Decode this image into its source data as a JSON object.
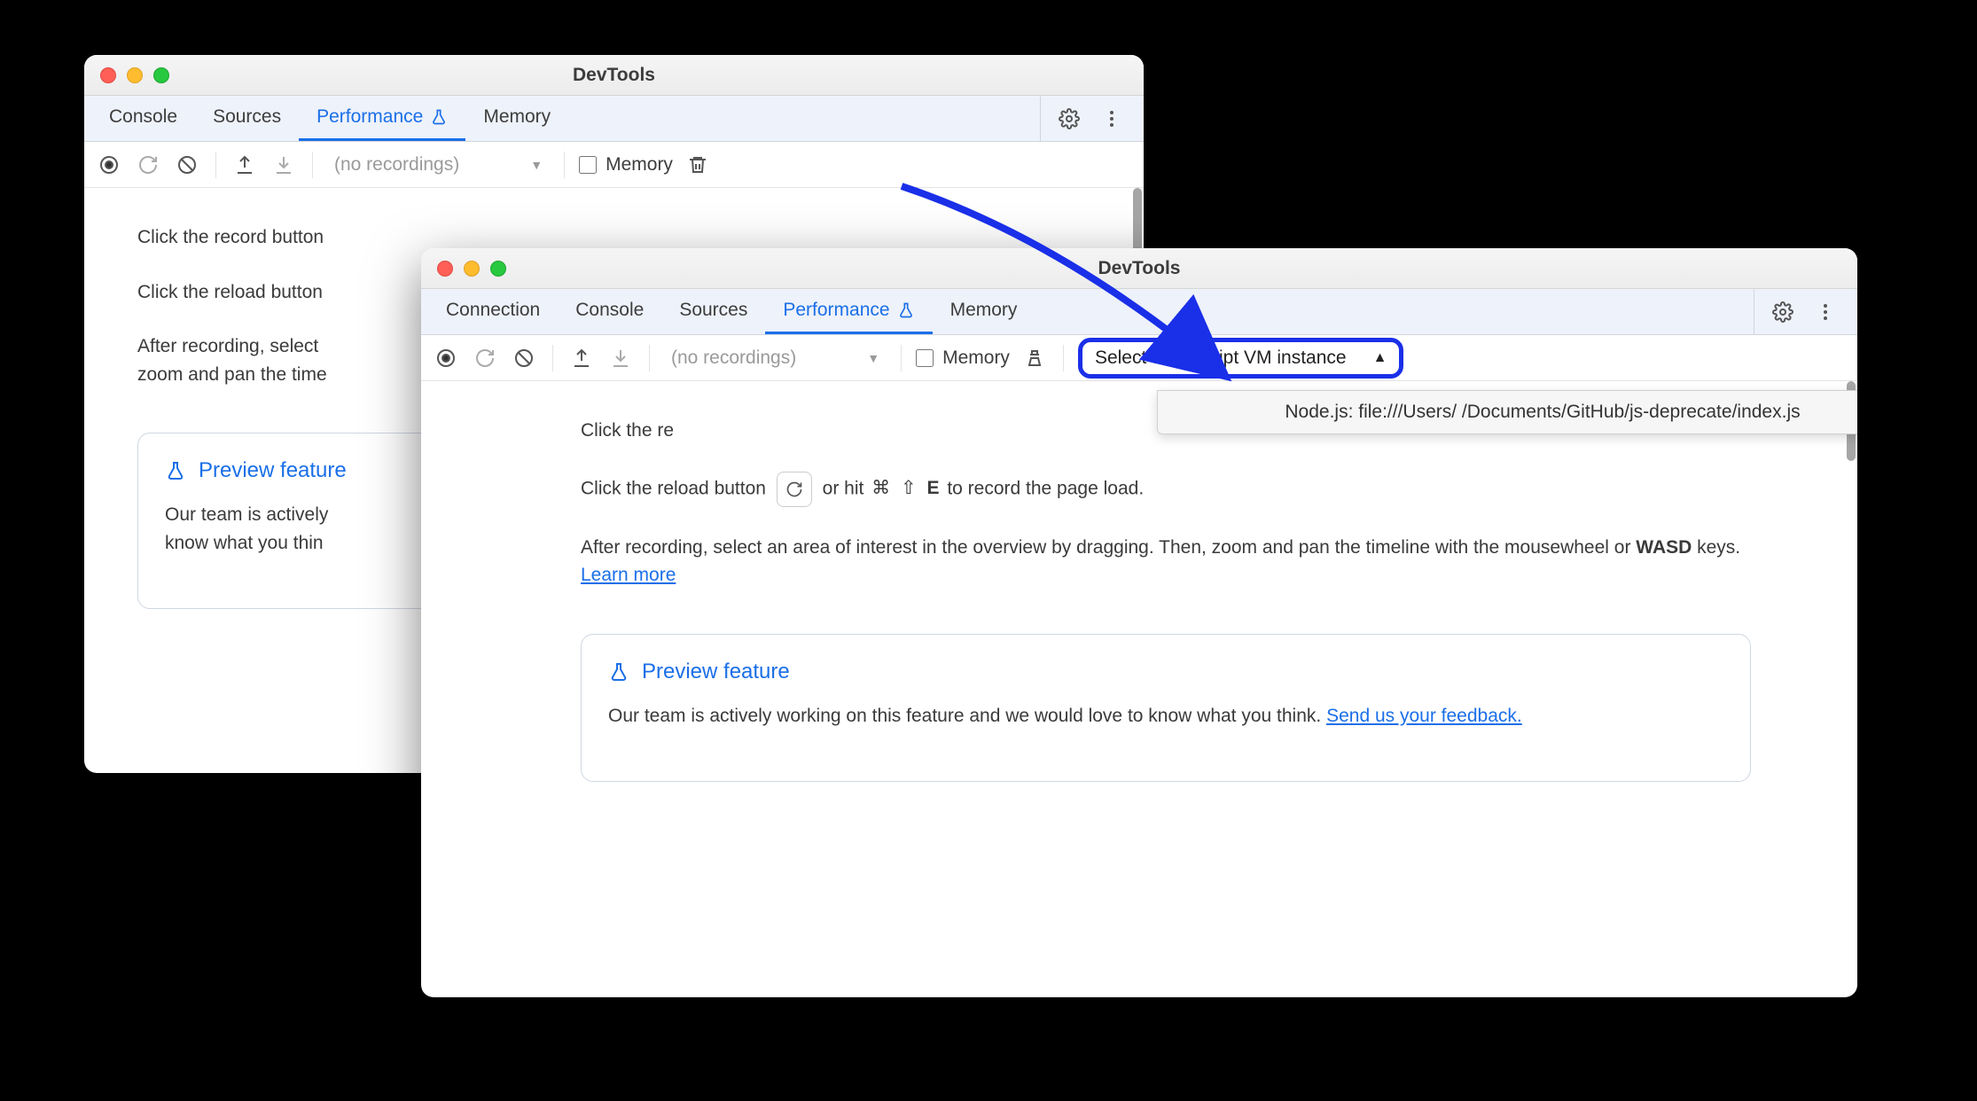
{
  "windowBack": {
    "title": "DevTools",
    "tabs": [
      "Console",
      "Sources",
      "Performance",
      "Memory"
    ],
    "activeTab": "Performance",
    "toolbar": {
      "recordings": "(no recordings)",
      "memoryLabel": "Memory"
    },
    "content": {
      "recordLine": "Click the record button",
      "reloadLine": "Click the reload button",
      "afterLine1": "After recording, select",
      "afterLine2": "zoom and pan the time",
      "previewTitle": "Preview feature",
      "previewBody1": "Our team is actively",
      "previewBody2": "know what you thin"
    }
  },
  "windowFront": {
    "title": "DevTools",
    "tabs": [
      "Connection",
      "Console",
      "Sources",
      "Performance",
      "Memory"
    ],
    "activeTab": "Performance",
    "toolbar": {
      "recordings": "(no recordings)",
      "memoryLabel": "Memory",
      "vmSelect": "Select JavaScript VM instance"
    },
    "dropdown": {
      "item": "Node.js: file:///Users/         /Documents/GitHub/js-deprecate/index.js"
    },
    "content": {
      "recordLinePrefix": "Click the re",
      "reloadLinePrefix": "Click the reload button ",
      "reloadLineSuffix": " or hit ",
      "reloadKey1": "⌘",
      "reloadKey2": "⇧",
      "reloadKey3": "E",
      "reloadLineEnd": " to record the page load.",
      "afterLine": "After recording, select an area of interest in the overview by dragging. Then, zoom and pan the timeline with the mousewheel or ",
      "wasd": "WASD",
      "afterSuffix": " keys. ",
      "learnMore": "Learn more",
      "previewTitle": "Preview feature",
      "previewBody": "Our team is actively working on this feature and we would love to know what you think. ",
      "feedbackLink": "Send us your feedback."
    }
  }
}
